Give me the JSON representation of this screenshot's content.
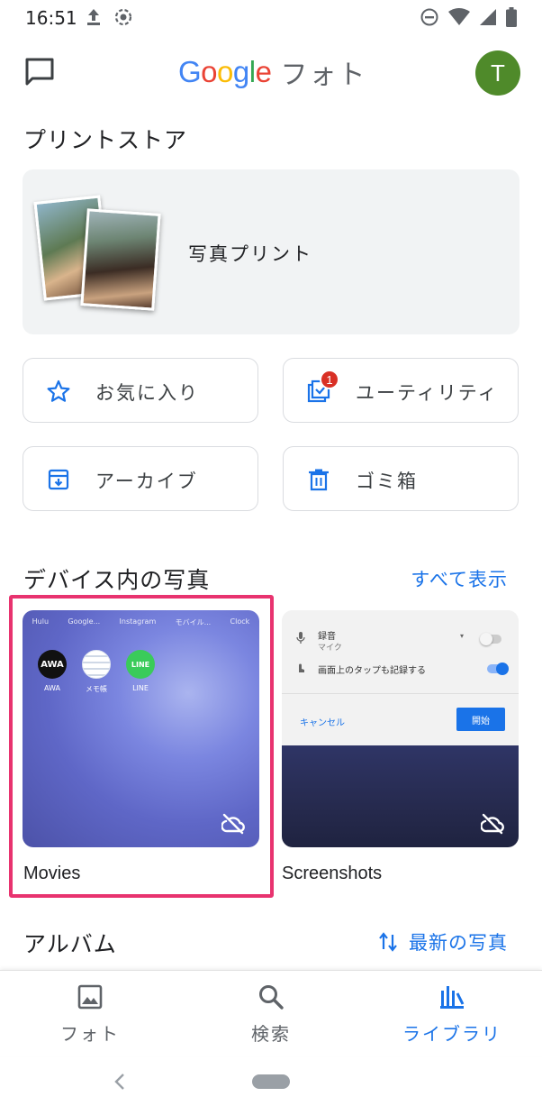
{
  "status_bar": {
    "time": "16:51"
  },
  "header": {
    "logo_google": [
      "G",
      "o",
      "o",
      "g",
      "l",
      "e"
    ],
    "logo_suffix": "フォト",
    "avatar_letter": "T"
  },
  "print_store": {
    "title": "プリントストア",
    "card_label": "写真プリント"
  },
  "chips": {
    "favorites": "お気に入り",
    "utilities": "ユーティリティ",
    "utilities_badge": "1",
    "archive": "アーカイブ",
    "trash": "ゴミ箱"
  },
  "device_photos": {
    "title": "デバイス内の写真",
    "see_all": "すべて表示",
    "folders": [
      {
        "name": "Movies",
        "backed_up": false
      },
      {
        "name": "Screenshots",
        "backed_up": false
      }
    ],
    "movies_thumb": {
      "top_row_labels": [
        "Hulu",
        "Google...",
        "Instagram",
        "モバイル...",
        "Clock"
      ],
      "apps": [
        {
          "icon_text": "AWA",
          "label": "AWA"
        },
        {
          "icon_text": "",
          "label": "メモ帳"
        },
        {
          "icon_text": "LINE",
          "label": "LINE"
        }
      ]
    },
    "screenshots_thumb": {
      "row1_title": "録音",
      "row1_sub": "マイク",
      "row2_title": "画面上のタップも記録する",
      "cancel": "キャンセル",
      "start": "開始"
    }
  },
  "albums": {
    "title": "アルバム",
    "sort_label": "最新の写真"
  },
  "bottom_nav": {
    "photos": "フォト",
    "search": "検索",
    "library": "ライブラリ",
    "active": "library"
  },
  "colors": {
    "accent": "#1a73e8",
    "highlight": "#e8336f",
    "avatar": "#4f8a2a",
    "badge": "#d93025"
  }
}
